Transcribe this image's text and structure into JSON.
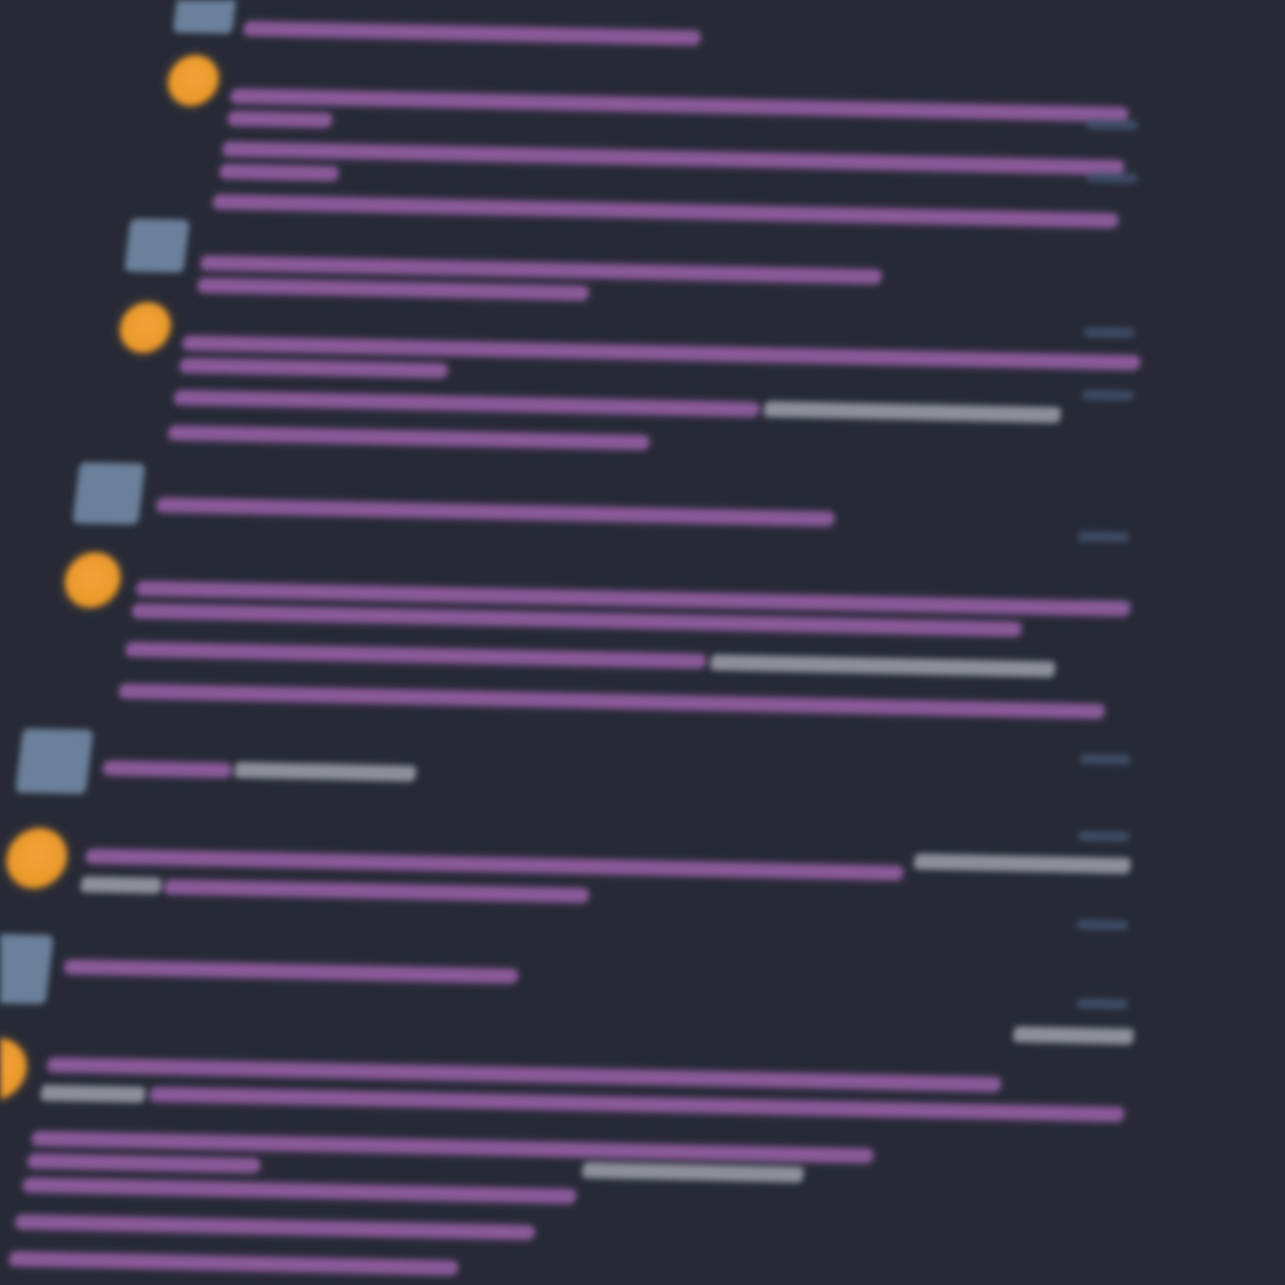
{
  "colors": {
    "background": "#272a36",
    "claude_avatar": "#eb9a2b",
    "user_avatar": "#6b809a",
    "message_text": "#8a5a99",
    "inline_code": "#8d8f99",
    "timestamp": "#3e4c66"
  },
  "messages": [
    {
      "role": "user",
      "avatar_icon": "user-avatar-square"
    },
    {
      "role": "claude",
      "avatar_icon": "claude-avatar-circle"
    },
    {
      "role": "user",
      "avatar_icon": "user-avatar-square"
    },
    {
      "role": "claude",
      "avatar_icon": "claude-avatar-circle"
    },
    {
      "role": "user",
      "avatar_icon": "user-avatar-square"
    },
    {
      "role": "claude",
      "avatar_icon": "claude-avatar-circle"
    },
    {
      "role": "user",
      "avatar_icon": "user-avatar-square"
    },
    {
      "role": "claude",
      "avatar_icon": "claude-avatar-circle"
    },
    {
      "role": "user",
      "avatar_icon": "user-avatar-square"
    },
    {
      "role": "claude",
      "avatar_icon": "claude-avatar-circle"
    }
  ]
}
